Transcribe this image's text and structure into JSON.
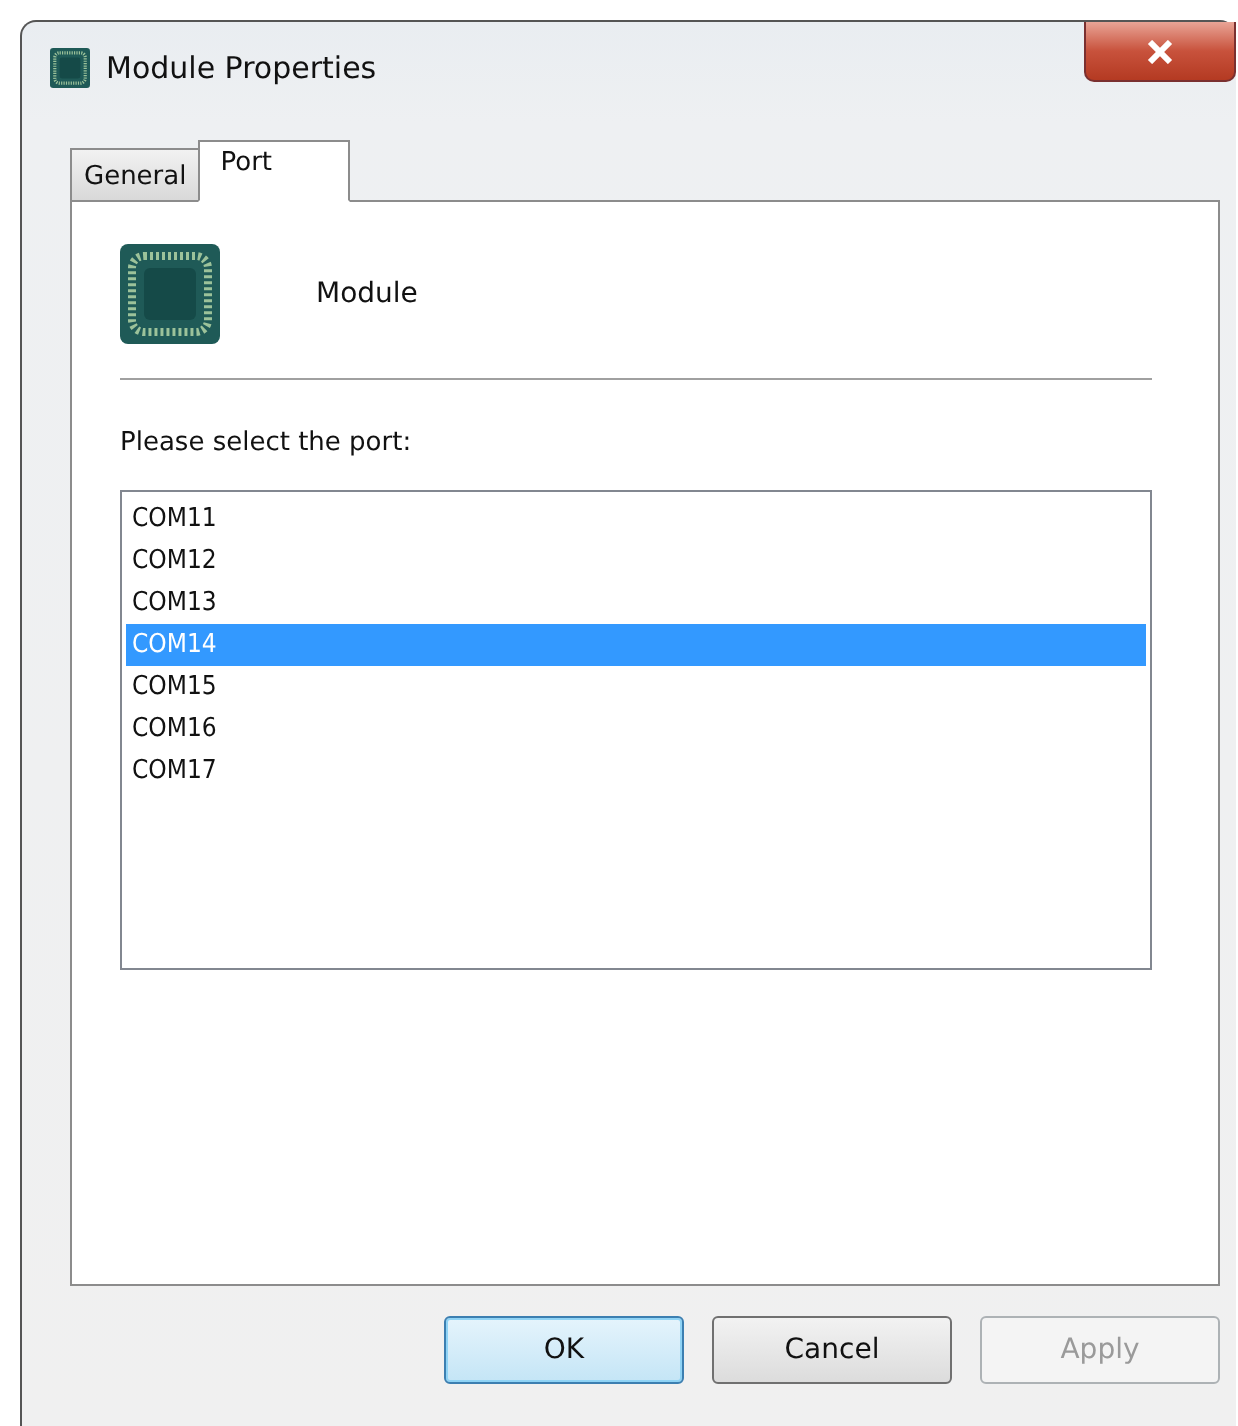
{
  "window": {
    "title": "Module Properties"
  },
  "tabs": [
    {
      "label": "General",
      "selected": false
    },
    {
      "label": "Port",
      "selected": true
    }
  ],
  "module": {
    "name": "Module"
  },
  "prompt": "Please select the port:",
  "ports": [
    {
      "label": "COM11",
      "selected": false
    },
    {
      "label": "COM12",
      "selected": false
    },
    {
      "label": "COM13",
      "selected": false
    },
    {
      "label": "COM14",
      "selected": true
    },
    {
      "label": "COM15",
      "selected": false
    },
    {
      "label": "COM16",
      "selected": false
    },
    {
      "label": "COM17",
      "selected": false
    }
  ],
  "buttons": [
    {
      "label": "OK",
      "kind": "default",
      "disabled": false
    },
    {
      "label": "Cancel",
      "kind": "normal",
      "disabled": false
    },
    {
      "label": "Apply",
      "kind": "normal",
      "disabled": true
    }
  ]
}
